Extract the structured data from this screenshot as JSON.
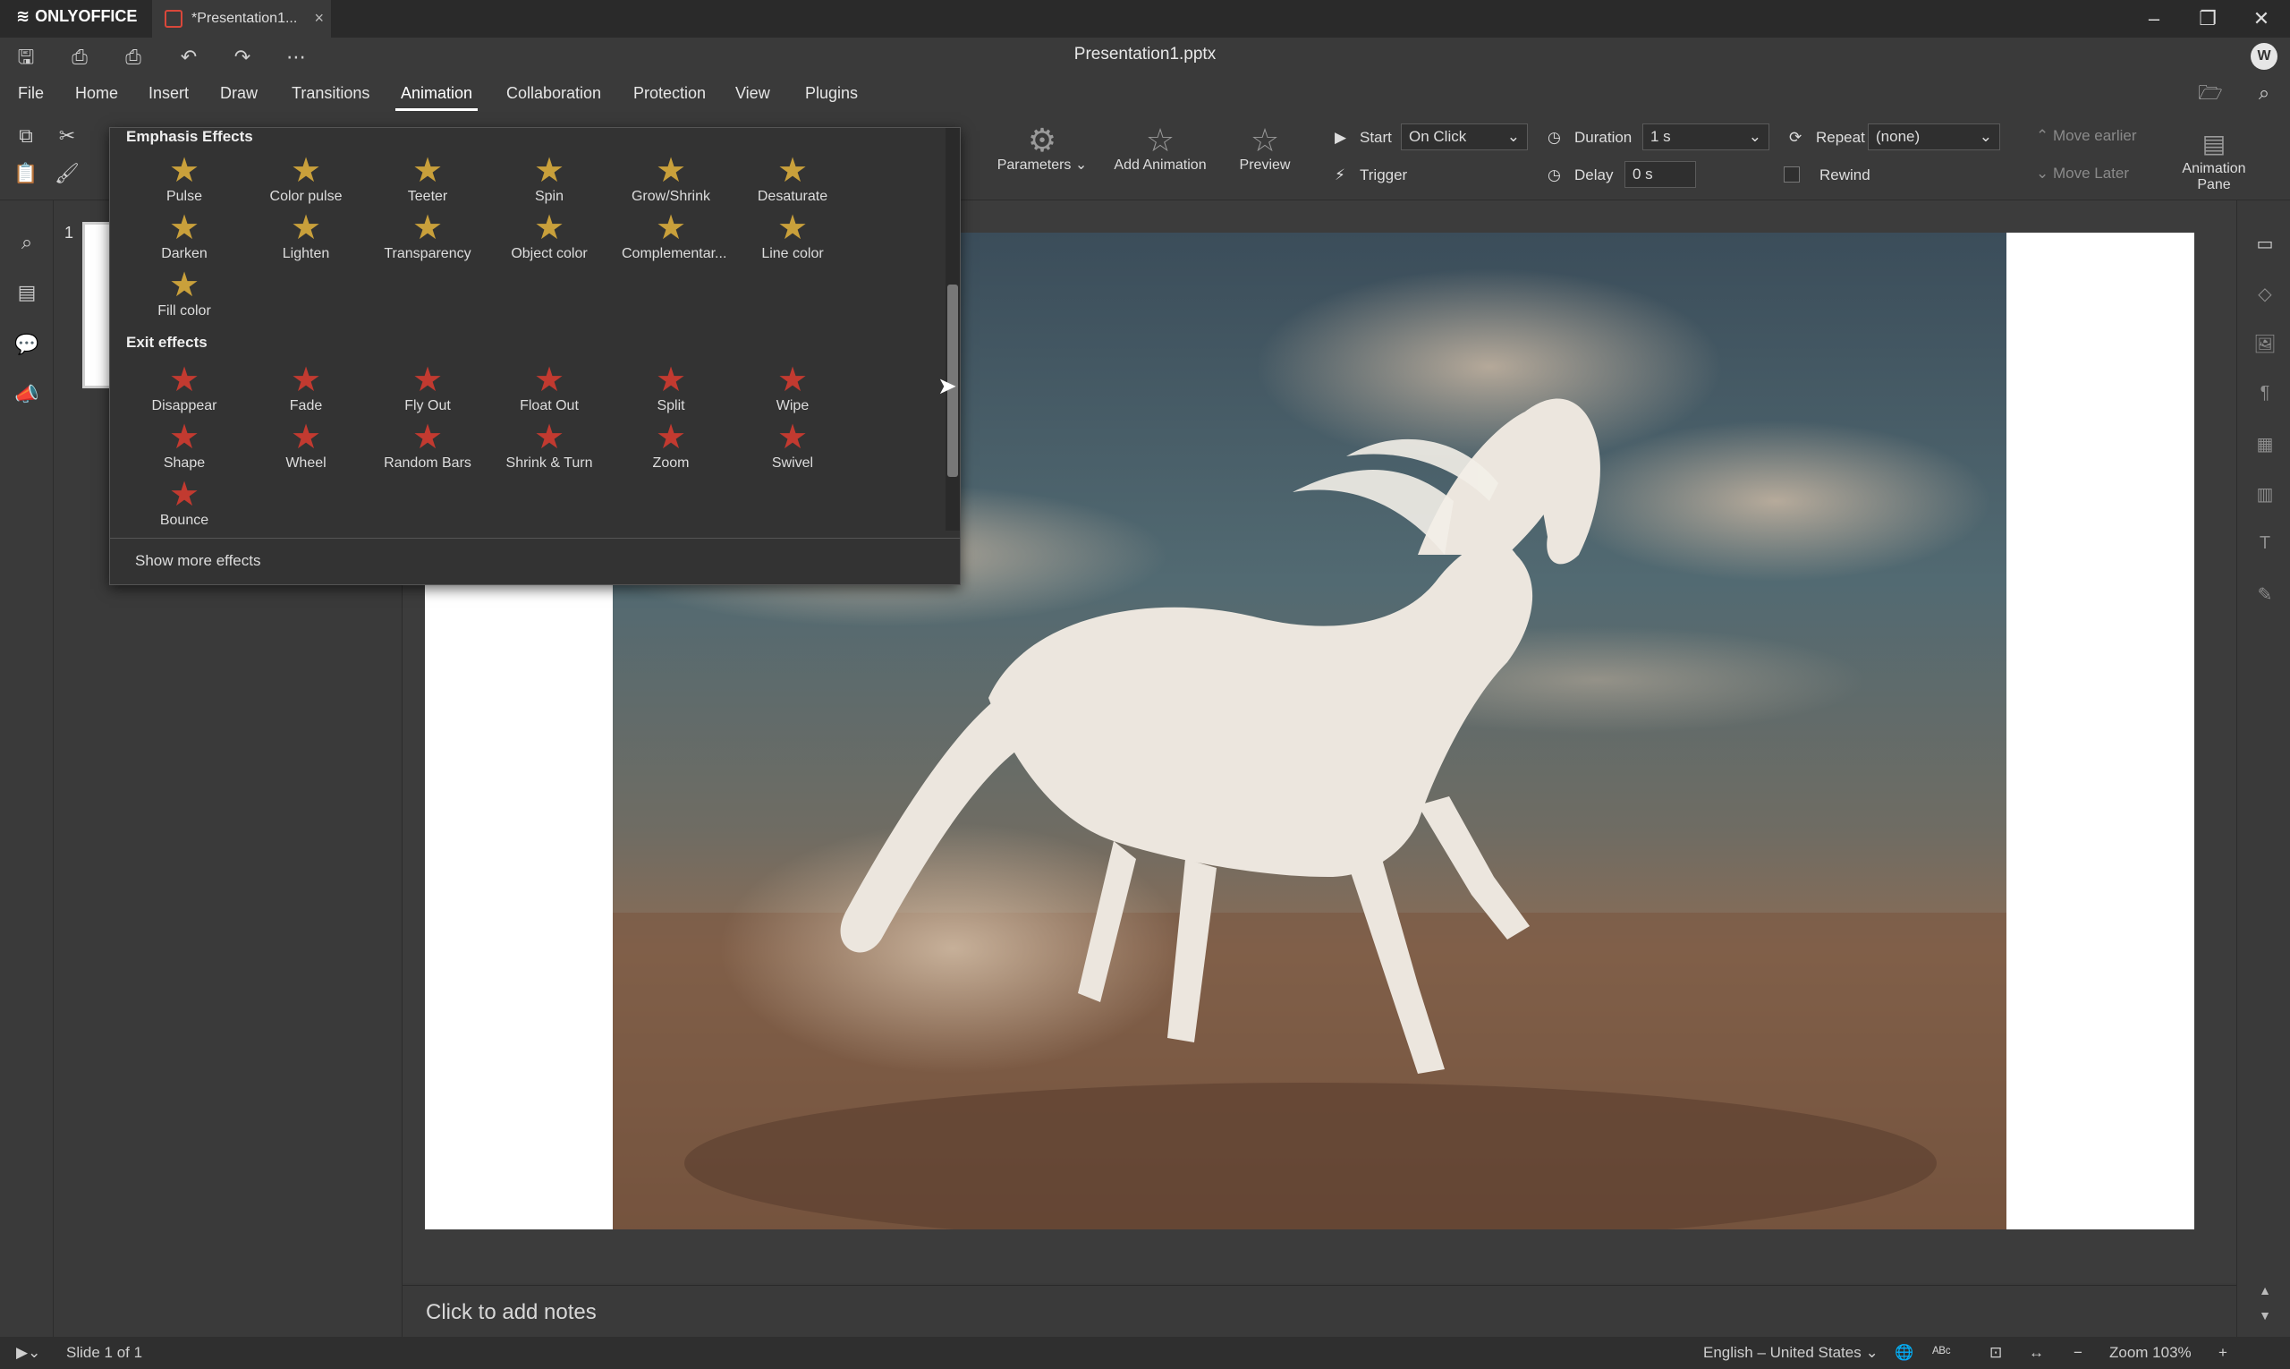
{
  "titlebar": {
    "brand": "ONLYOFFICE",
    "tab_label": "*Presentation1...",
    "minimize": "–",
    "restore": "❐",
    "close": "✕"
  },
  "header": {
    "doc_title": "Presentation1.pptx",
    "user_initial": "W"
  },
  "menu": {
    "tabs": [
      "File",
      "Home",
      "Insert",
      "Draw",
      "Transitions",
      "Animation",
      "Collaboration",
      "Protection",
      "View",
      "Plugins"
    ],
    "active": "Animation"
  },
  "ribbon": {
    "parameters": "Parameters",
    "add_animation": "Add Animation",
    "preview": "Preview",
    "start_label": "Start",
    "start_value": "On Click",
    "trigger_label": "Trigger",
    "duration_label": "Duration",
    "duration_value": "1 s",
    "delay_label": "Delay",
    "delay_value": "0 s",
    "repeat_label": "Repeat",
    "repeat_value": "(none)",
    "rewind_label": "Rewind",
    "move_earlier": "Move earlier",
    "move_later": "Move Later",
    "animation_pane": "Animation Pane"
  },
  "slide_panel": {
    "slide_number": "1"
  },
  "effects_dropdown": {
    "emphasis_title": "Emphasis Effects",
    "emphasis": [
      "Pulse",
      "Color pulse",
      "Teeter",
      "Spin",
      "Grow/Shrink",
      "Desaturate",
      "Darken",
      "Lighten",
      "Transparency",
      "Object color",
      "Complementar...",
      "Line color",
      "Fill color"
    ],
    "exit_title": "Exit effects",
    "exit": [
      "Disappear",
      "Fade",
      "Fly Out",
      "Float Out",
      "Split",
      "Wipe",
      "Shape",
      "Wheel",
      "Random Bars",
      "Shrink & Turn",
      "Zoom",
      "Swivel",
      "Bounce"
    ],
    "show_more": "Show more effects"
  },
  "notes": {
    "placeholder": "Click to add notes"
  },
  "status": {
    "slide_info": "Slide 1 of 1",
    "language": "English – United States",
    "zoom": "Zoom 103%"
  },
  "colors": {
    "emphasis_star": "#c9a03b",
    "exit_star": "#c23a30",
    "active_tab_underline": "#ffffff"
  }
}
